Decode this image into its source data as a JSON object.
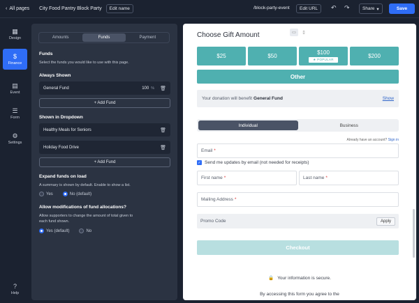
{
  "topbar": {
    "back_label": "All pages",
    "page_title": "City Food Pantry Block Party",
    "edit_name": "Edit name",
    "url": "/block-party-event",
    "edit_url": "Edit URL",
    "share": "Share",
    "save": "Save"
  },
  "rail": {
    "design": "Design",
    "finance": "Finance",
    "event": "Event",
    "form": "Form",
    "settings": "Settings",
    "help": "Help"
  },
  "panel": {
    "tabs": [
      "Amounts",
      "Funds",
      "Payment"
    ],
    "funds_heading": "Funds",
    "funds_desc": "Select the funds you would like to use with this page.",
    "always_shown": "Always Shown",
    "always_funds": [
      {
        "name": "General Fund",
        "pct": "100",
        "pct_sign": "%"
      }
    ],
    "add_fund": "+ Add Fund",
    "dropdown_heading": "Shown in Dropdown",
    "dropdown_funds": [
      "Healthy Meals for Seniors",
      "Holiday Food Drive"
    ],
    "expand_heading": "Expand funds on load",
    "expand_desc": "A summary is shown by default. Enable to show a list.",
    "expand_yes": "Yes",
    "expand_no": "No (default)",
    "allow_heading": "Allow modifications of fund allocations?",
    "allow_desc_1": "Allow supporters to change the amount of total given to",
    "allow_desc_2": "each fund shown.",
    "allow_yes": "Yes (default)",
    "allow_no": "No"
  },
  "preview": {
    "title": "Choose Gift Amount",
    "amounts": [
      "$25",
      "$50",
      "$100",
      "$200"
    ],
    "popular": "POPULAR",
    "other": "Other",
    "benefit_prefix": "Your donation will benefit",
    "benefit_fund": "General Fund",
    "show": "Show",
    "toggle": [
      "Individual",
      "Business"
    ],
    "have_account": "Already have an account?",
    "sign_in": "Sign in",
    "email": "Email",
    "updates": "Send me updates by email (not needed for receipts)",
    "first_name": "First name",
    "last_name": "Last name",
    "mailing": "Mailing Address",
    "promo": "Promo Code",
    "apply": "Apply",
    "checkout": "Checkout",
    "secure": "Your information is secure.",
    "agree": "By accessing this form you agree to the",
    "required_mark": "*"
  },
  "colors": {
    "accent": "#2f6df6",
    "teal": "#4fb0b0",
    "panel": "#2b3342",
    "background": "#1b2230"
  }
}
